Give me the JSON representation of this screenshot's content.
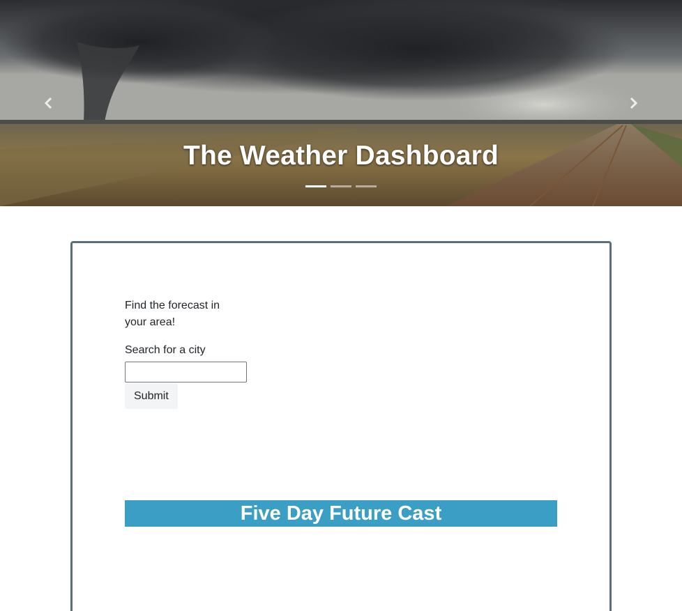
{
  "hero": {
    "title": "The Weather Dashboard",
    "prev_icon": "chevron-left-icon",
    "next_icon": "chevron-right-icon",
    "slide_count": 3,
    "active_slide": 1
  },
  "search": {
    "tagline": "Find the forecast in your area!",
    "label": "Search for a city",
    "value": "",
    "submit_label": "Submit"
  },
  "forecast": {
    "title": "Five Day Future Cast"
  },
  "colors": {
    "card_border": "#5b6e79",
    "forecast_header_bg": "#3b9ec4",
    "submit_bg": "#f3f4f5"
  }
}
